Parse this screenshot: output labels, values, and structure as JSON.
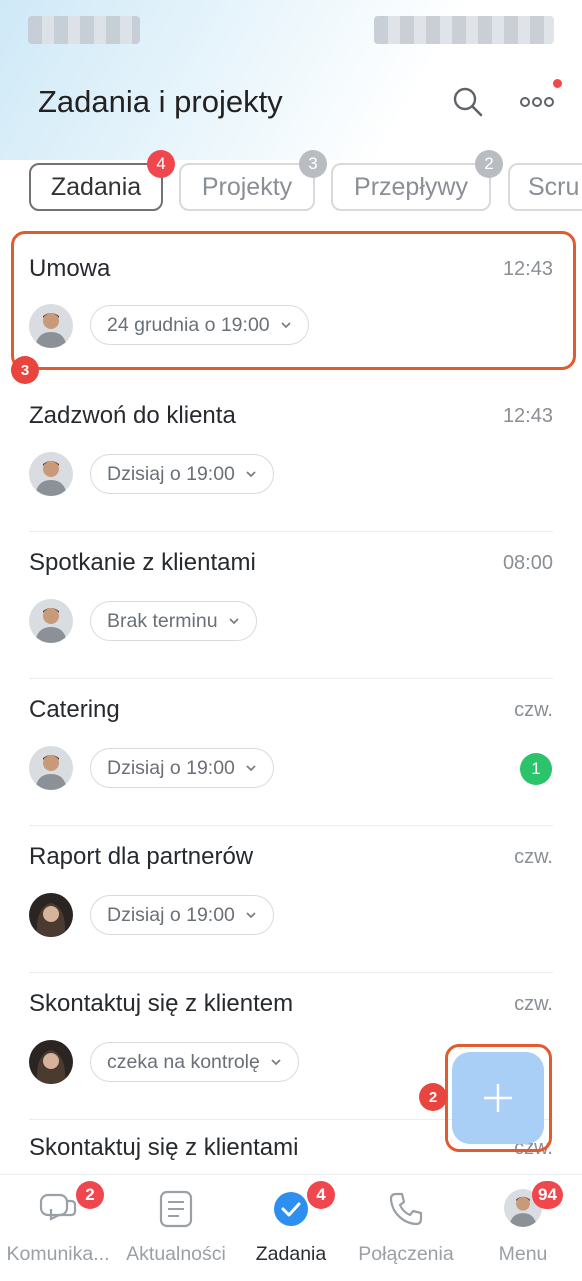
{
  "header": {
    "title": "Zadania i projekty",
    "search_icon": "search-icon",
    "more_icon": "more-dots-icon"
  },
  "tabs": [
    {
      "label": "Zadania",
      "badge": "4",
      "active": true
    },
    {
      "label": "Projekty",
      "badge": "3",
      "active": false
    },
    {
      "label": "Przepływy",
      "badge": "2",
      "active": false
    },
    {
      "label": "Scru",
      "badge": "",
      "active": false
    }
  ],
  "tasks": [
    {
      "title": "Umowa",
      "time": "12:43",
      "deadline": "24 grudnia o 19:00",
      "avatar": "man-avatar"
    },
    {
      "title": "Zadzwoń do klienta",
      "time": "12:43",
      "deadline": "Dzisiaj o 19:00",
      "avatar": "man-avatar"
    },
    {
      "title": "Spotkanie z klientami",
      "time": "08:00",
      "deadline": "Brak terminu",
      "avatar": "man-avatar"
    },
    {
      "title": "Catering",
      "time": "czw.",
      "deadline": "Dzisiaj o 19:00",
      "avatar": "man-avatar",
      "comments": "1"
    },
    {
      "title": "Raport dla partnerów",
      "time": "czw.",
      "deadline": "Dzisiaj o 19:00",
      "avatar": "woman-avatar"
    },
    {
      "title": "Skontaktuj się z klientem",
      "time": "czw.",
      "deadline": "czeka na kontrolę",
      "avatar": "woman-avatar"
    },
    {
      "title": "Skontaktuj się z klientami",
      "time": "czw."
    }
  ],
  "annotations": {
    "marker_tasks": "3",
    "marker_fab": "2"
  },
  "bottom_nav": [
    {
      "label": "Komunika...",
      "icon": "chat-icon",
      "badge": "2"
    },
    {
      "label": "Aktualności",
      "icon": "news-icon",
      "badge": ""
    },
    {
      "label": "Zadania",
      "icon": "tasks-check-icon",
      "badge": "4",
      "active": true
    },
    {
      "label": "Połączenia",
      "icon": "phone-icon",
      "badge": ""
    },
    {
      "label": "Menu",
      "icon": "avatar-icon",
      "badge": "94"
    }
  ],
  "colors": {
    "accent_blue": "#2d8ff0",
    "badge_red": "#f0474f",
    "highlight": "#e35a2f",
    "green": "#2bc46a",
    "fab": "#a9cff7"
  }
}
